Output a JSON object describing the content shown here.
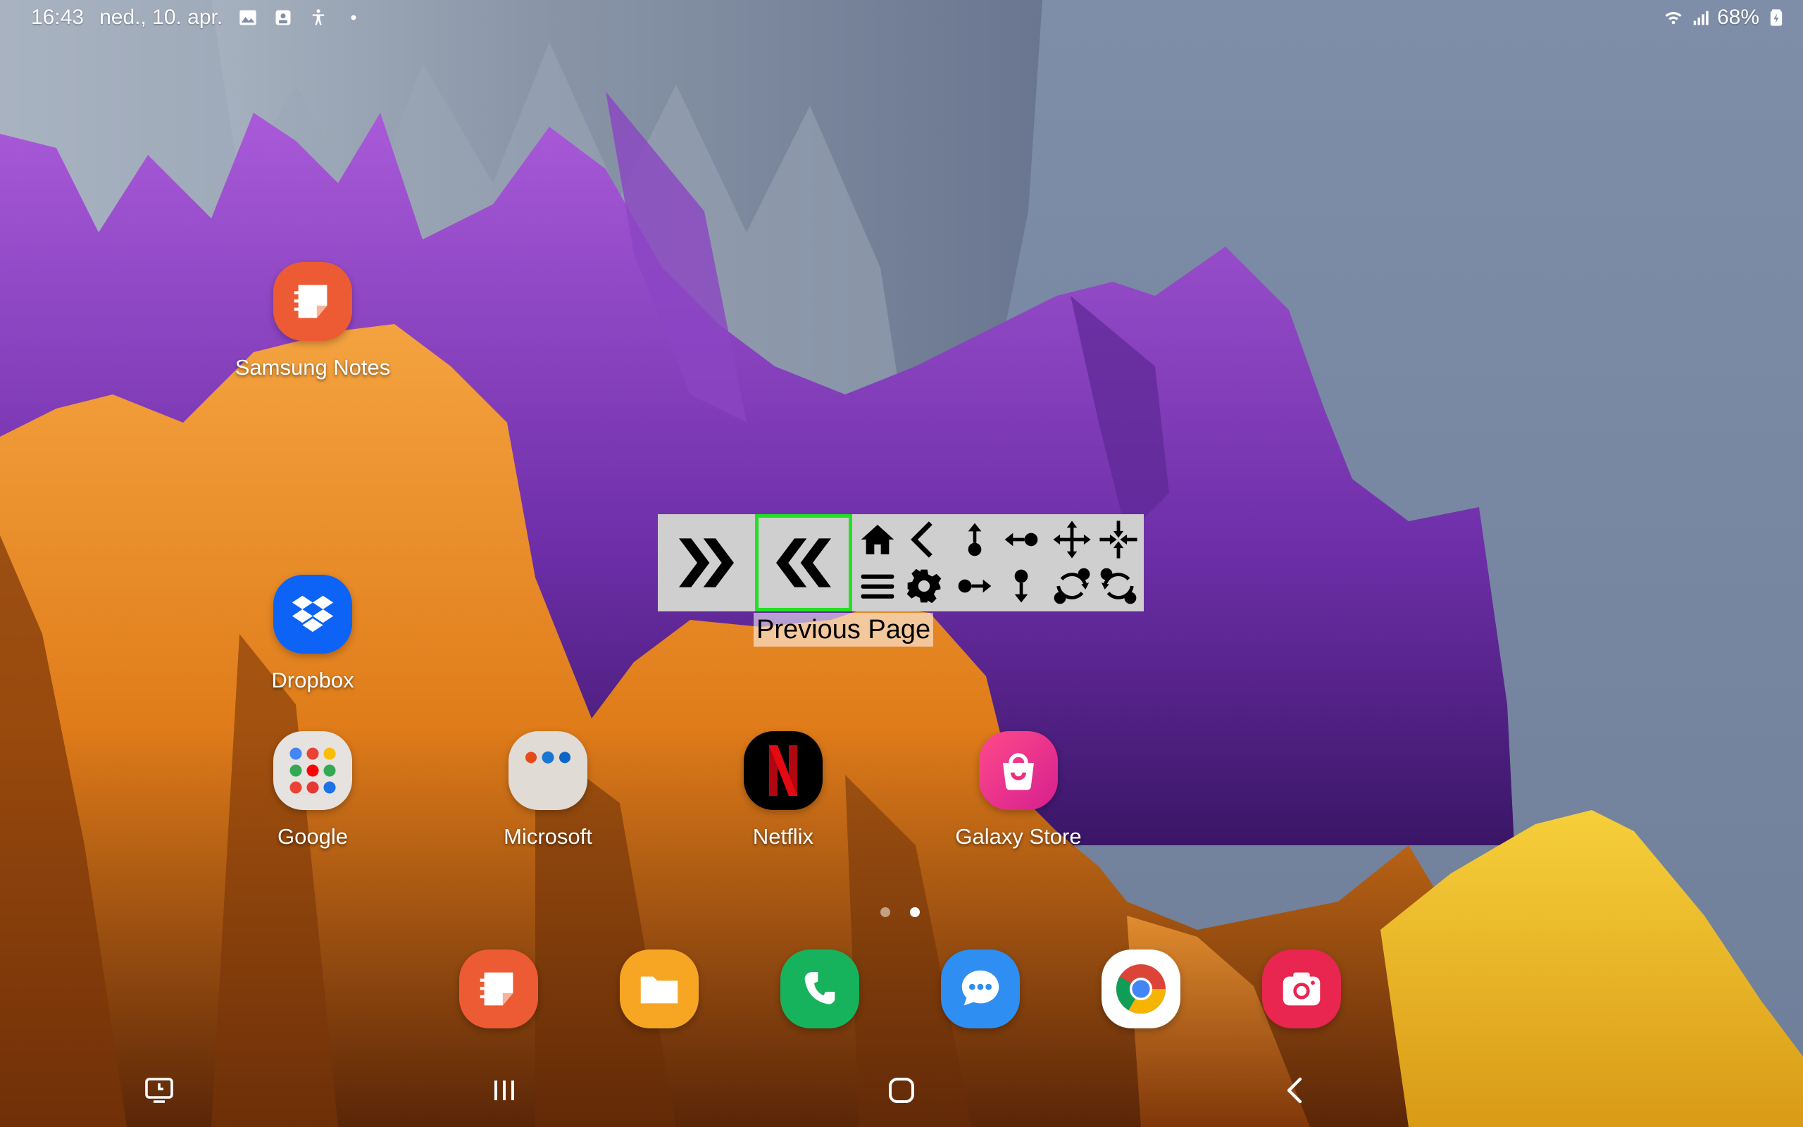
{
  "status_bar": {
    "time": "16:43",
    "date": "ned., 10. apr.",
    "battery": "68%",
    "left_icons": [
      "gallery-icon",
      "screenshot-icon",
      "accessibility-icon",
      "dot-icon"
    ],
    "right_icons": [
      "wifi-icon",
      "signal-icon",
      "battery-icon"
    ]
  },
  "home_apps": [
    {
      "label": "Samsung Notes",
      "icon": "samsung-notes-icon",
      "color": "#ec5b33"
    },
    {
      "label": "Dropbox",
      "icon": "dropbox-icon",
      "color": "#0d63f5"
    },
    {
      "label": "Google",
      "icon": "google-folder-icon",
      "color": "#e6e2df"
    },
    {
      "label": "Microsoft",
      "icon": "microsoft-folder-icon",
      "color": "#e1dbd6"
    },
    {
      "label": "Netflix",
      "icon": "netflix-icon",
      "color": "#000000"
    },
    {
      "label": "Galaxy Store",
      "icon": "galaxy-store-icon",
      "color": "#f2357d"
    }
  ],
  "dock": [
    {
      "name": "samsung-notes",
      "icon": "samsung-notes-icon",
      "color": "#ec5b33"
    },
    {
      "name": "my-files",
      "icon": "folder-icon",
      "color": "#f6a623"
    },
    {
      "name": "phone",
      "icon": "phone-icon",
      "color": "#17b35c"
    },
    {
      "name": "messages",
      "icon": "messages-icon",
      "color": "#2f8ef2"
    },
    {
      "name": "chrome",
      "icon": "chrome-icon",
      "color": "#ffffff"
    },
    {
      "name": "camera",
      "icon": "camera-icon",
      "color": "#e8264f"
    }
  ],
  "page_indicator": {
    "pages": 2,
    "current": 2
  },
  "toolbar": {
    "buttons": [
      "next-page",
      "previous-page",
      "home-back-menu-settings",
      "drag-controls",
      "zoom-rotate"
    ],
    "selected": "previous-page",
    "tooltip": "Previous Page",
    "highlight_color": "#22e022"
  },
  "navigation_bar": [
    "recent-screens-icon",
    "recent-apps-icon",
    "home-icon",
    "back-icon"
  ]
}
